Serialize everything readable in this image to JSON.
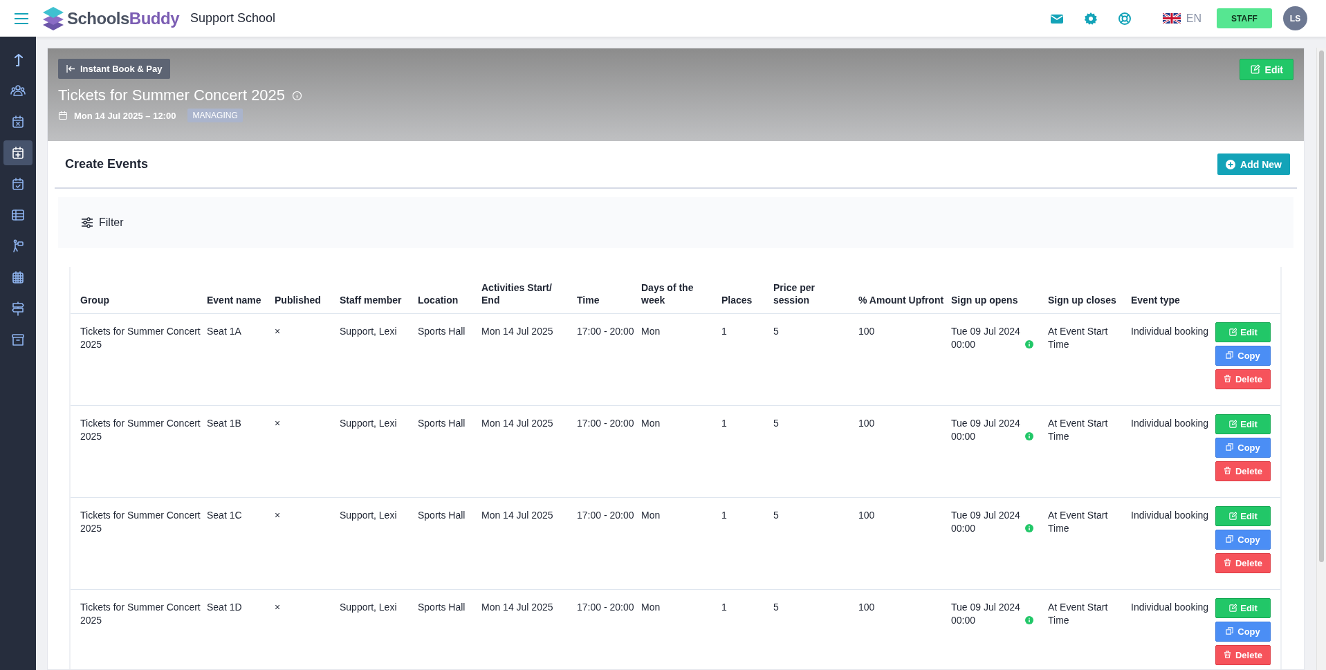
{
  "topbar": {
    "brand_prefix": "Schools",
    "brand_suffix": "Buddy",
    "school": "Support School",
    "language": "EN",
    "role_button": "STAFF",
    "avatar": "LS"
  },
  "sidebar": {
    "items": [
      {
        "kind": "arrow",
        "selected": false
      },
      {
        "kind": "people",
        "selected": false
      },
      {
        "kind": "calendar-x",
        "selected": false
      },
      {
        "kind": "calendar-plus",
        "selected": true
      },
      {
        "kind": "calendar-check",
        "selected": false
      },
      {
        "kind": "table",
        "selected": false
      },
      {
        "kind": "person-board",
        "selected": false
      },
      {
        "kind": "calendar-grid",
        "selected": false
      },
      {
        "kind": "signpost",
        "selected": false
      },
      {
        "kind": "archive",
        "selected": false
      }
    ]
  },
  "banner": {
    "back_button": "Instant Book & Pay",
    "edit_button": "Edit",
    "title": "Tickets for Summer Concert 2025",
    "date": "Mon 14 Jul 2025 – 12:00",
    "badge": "MANAGING"
  },
  "section": {
    "title": "Create Events",
    "add_button": "Add New",
    "filter_button": "Filter"
  },
  "table": {
    "columns": [
      "Group",
      "Event name",
      "Published",
      "Staff member",
      "Location",
      "Activities Start/ End",
      "Time",
      "Days of the week",
      "Places",
      "Price per session",
      "% Amount Upfront",
      "Sign up opens",
      "Sign up closes",
      "Event type"
    ],
    "rows": [
      {
        "cells": [
          "Tickets for Summer Concert 2025",
          "Seat 1A",
          "×",
          "Support, Lexi",
          "Sports Hall",
          "Mon 14 Jul 2025",
          "17:00 - 20:00",
          "Mon",
          "1",
          "5",
          "100",
          "Tue 09 Jul 2024 00:00",
          "At Event Start Time",
          "Individual booking"
        ],
        "actions": [
          {
            "kind": "edit",
            "label": "Edit"
          },
          {
            "kind": "copy",
            "label": "Copy"
          },
          {
            "kind": "delete",
            "label": "Delete"
          }
        ]
      },
      {
        "cells": [
          "Tickets for Summer Concert 2025",
          "Seat 1B",
          "×",
          "Support, Lexi",
          "Sports Hall",
          "Mon 14 Jul 2025",
          "17:00 - 20:00",
          "Mon",
          "1",
          "5",
          "100",
          "Tue 09 Jul 2024 00:00",
          "At Event Start Time",
          "Individual booking"
        ],
        "actions": [
          {
            "kind": "edit",
            "label": "Edit"
          },
          {
            "kind": "copy",
            "label": "Copy"
          },
          {
            "kind": "delete",
            "label": "Delete"
          }
        ]
      },
      {
        "cells": [
          "Tickets for Summer Concert 2025",
          "Seat 1C",
          "×",
          "Support, Lexi",
          "Sports Hall",
          "Mon 14 Jul 2025",
          "17:00 - 20:00",
          "Mon",
          "1",
          "5",
          "100",
          "Tue 09 Jul 2024 00:00",
          "At Event Start Time",
          "Individual booking"
        ],
        "actions": [
          {
            "kind": "edit",
            "label": "Edit"
          },
          {
            "kind": "copy",
            "label": "Copy"
          },
          {
            "kind": "delete",
            "label": "Delete"
          }
        ]
      },
      {
        "cells": [
          "Tickets for Summer Concert 2025",
          "Seat 1D",
          "×",
          "Support, Lexi",
          "Sports Hall",
          "Mon 14 Jul 2025",
          "17:00 - 20:00",
          "Mon",
          "1",
          "5",
          "100",
          "Tue 09 Jul 2024 00:00",
          "At Event Start Time",
          "Individual booking"
        ],
        "actions": [
          {
            "kind": "edit",
            "label": "Edit"
          },
          {
            "kind": "copy",
            "label": "Copy"
          },
          {
            "kind": "delete",
            "label": "Delete"
          }
        ]
      }
    ]
  }
}
